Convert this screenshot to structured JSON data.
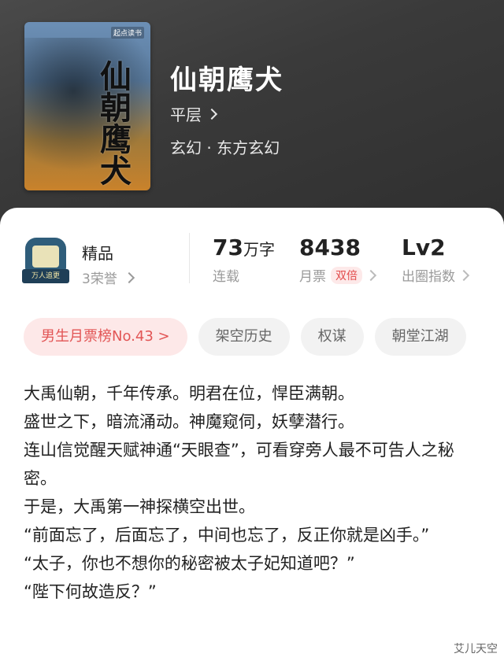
{
  "book": {
    "title": "仙朝鹰犬",
    "author": "平层",
    "genre": "玄幻 · 东方玄幻",
    "cover": {
      "badge": "起点读书",
      "title": "仙朝鹰犬"
    }
  },
  "quality": {
    "badge_text": "万人追更",
    "label": "精品",
    "honors": "3荣誉"
  },
  "stats": [
    {
      "value": "73",
      "unit": "万字",
      "label": "连载"
    },
    {
      "value": "8438",
      "unit": "",
      "label": "月票",
      "badge": "双倍"
    },
    {
      "value": "Lv2",
      "unit": "",
      "label": "出圈指数"
    }
  ],
  "tags": [
    "男生月票榜No.43 >",
    "架空历史",
    "权谋",
    "朝堂江湖"
  ],
  "description": [
    "大禹仙朝，千年传承。明君在位，悍臣满朝。",
    "盛世之下，暗流涌动。神魔窥伺，妖孽潜行。",
    "连山信觉醒天赋神通“天眼查”，可看穿旁人最不可告人之秘密。",
    "于是，大禹第一神探横空出世。",
    "“前面忘了，后面忘了，中间也忘了，反正你就是凶手。”",
    "“太子，你也不想你的秘密被太子妃知道吧？”",
    "“陛下何故造反？”"
  ],
  "watermark": "艾儿天空"
}
